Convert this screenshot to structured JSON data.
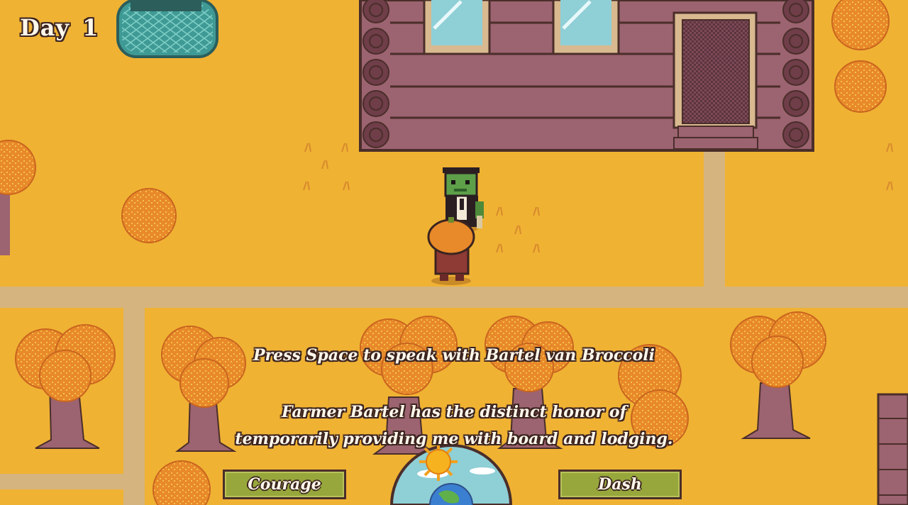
{
  "hud": {
    "day_word": "Day",
    "day_number": "1"
  },
  "interaction": {
    "prompt": "Press Space to speak with Bartel van Broccoli"
  },
  "dialogue": {
    "line1": "Farmer Bartel has the distinct honor of",
    "line2": "temporarily providing me with board and lodging."
  },
  "abilities": {
    "left_label": "Courage",
    "right_label": "Dash"
  },
  "colors": {
    "ground": "#f0b233",
    "path": "#d5b47f",
    "cabin_wall": "#9c6370",
    "cabin_outline": "#4a2e2a",
    "tree_foliage": "#e8892a",
    "button_fill": "#97a73c",
    "text": "#fff7ea",
    "text_outline": "#3b2420"
  }
}
